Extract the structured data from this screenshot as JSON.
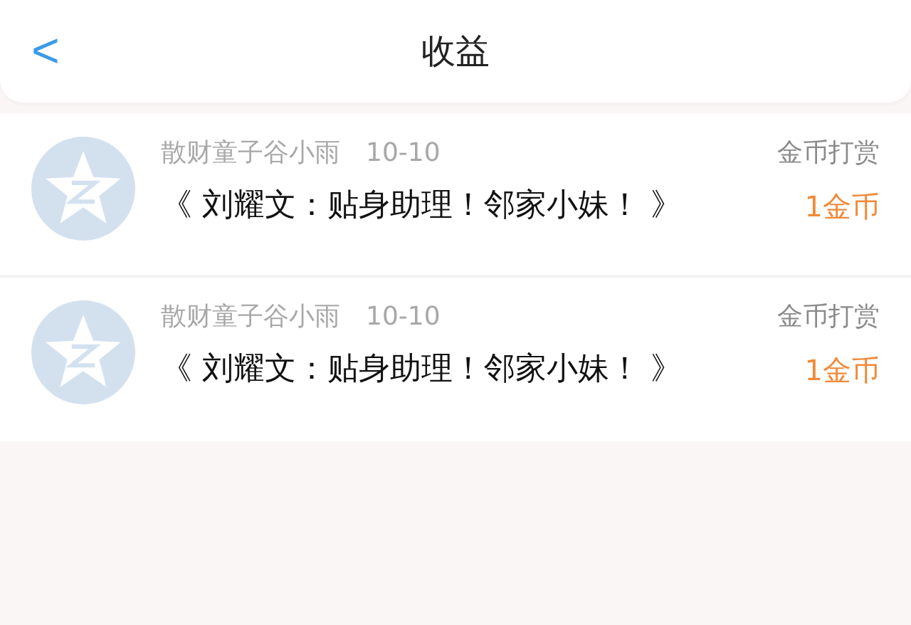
{
  "header": {
    "back": "<",
    "title": "收益"
  },
  "items": [
    {
      "name": "散财童子谷小雨",
      "date": "10-10",
      "book": "《 刘耀文：贴身助理！邻家小妹！ 》",
      "type": "金币打赏",
      "amount": "1金币"
    },
    {
      "name": "散财童子谷小雨",
      "date": "10-10",
      "book": "《 刘耀文：贴身助理！邻家小妹！ 》",
      "type": "金币打赏",
      "amount": "1金币"
    }
  ]
}
